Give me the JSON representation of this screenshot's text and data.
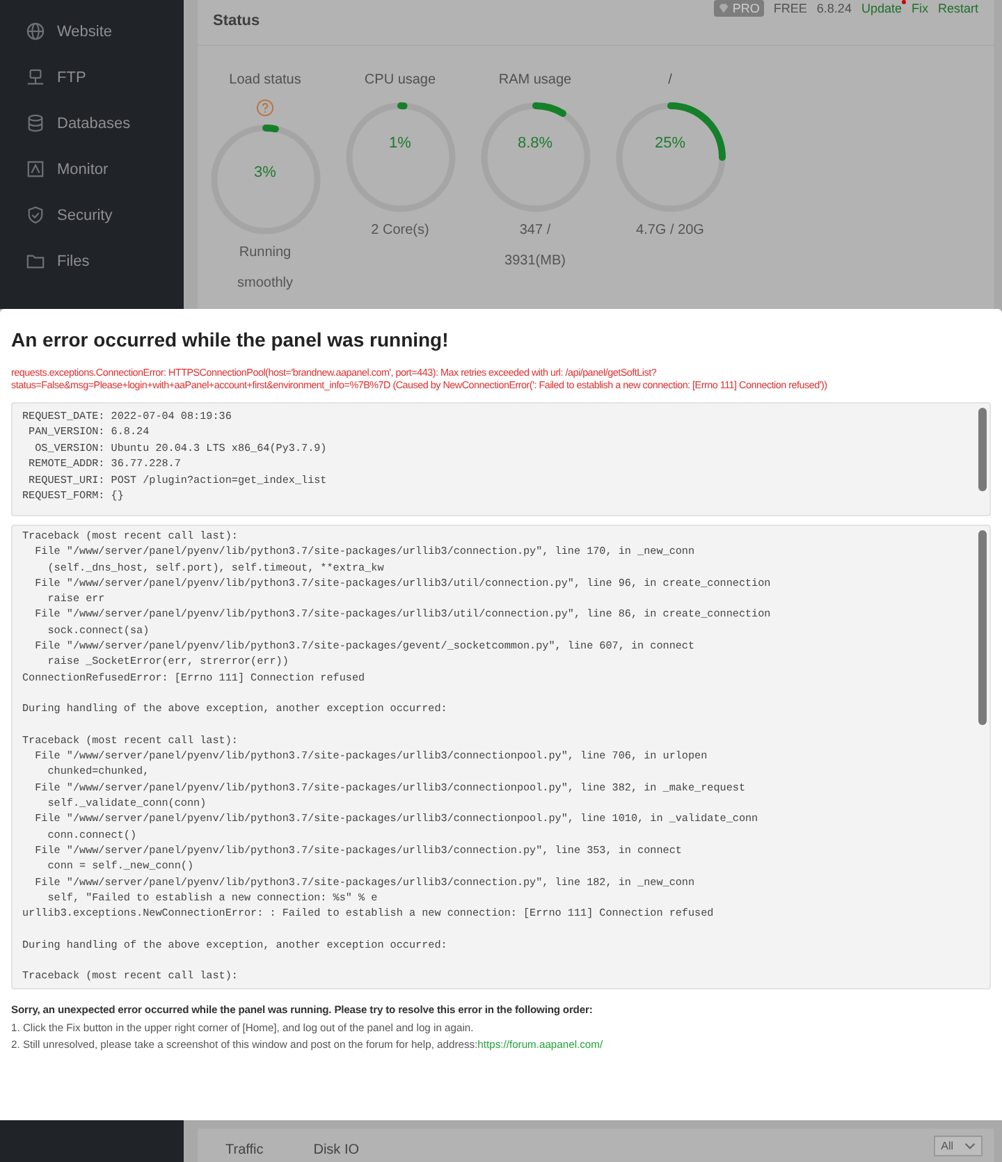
{
  "sidebar": {
    "items": [
      {
        "label": "Website"
      },
      {
        "label": "FTP"
      },
      {
        "label": "Databases"
      },
      {
        "label": "Monitor"
      },
      {
        "label": "Security"
      },
      {
        "label": "Files"
      }
    ]
  },
  "header": {
    "title": "Status",
    "badge": "PRO",
    "edition": "FREE",
    "version": "6.8.24",
    "links": [
      {
        "label": "Update",
        "notice": true
      },
      {
        "label": "Fix",
        "notice": false
      },
      {
        "label": "Restart",
        "notice": false
      }
    ]
  },
  "gauges": [
    {
      "label": "Load status",
      "help": true,
      "level": 0.03,
      "value": "3%",
      "caption": [
        "Running",
        "smoothly"
      ]
    },
    {
      "label": "CPU usage",
      "help": false,
      "level": 0.01,
      "value": "1%",
      "caption": [
        "2 Core(s)"
      ]
    },
    {
      "label": "RAM usage",
      "help": false,
      "level": 0.088,
      "value": "8.8%",
      "caption": [
        "347 /",
        "3931(MB)"
      ]
    },
    {
      "label": "/",
      "help": false,
      "level": 0.25,
      "value": "25%",
      "caption": [
        "4.7G / 20G"
      ]
    }
  ],
  "modal": {
    "title": "An error occurred while the panel was running!",
    "error": "requests.exceptions.ConnectionError: HTTPSConnectionPool(host='brandnew.aapanel.com', port=443): Max retries exceeded with url: /api/panel/getSoftList?status=False&msg=Please+login+with+aaPanel+account+first&environment_info=%7B%7D (Caused by NewConnectionError(': Failed to establish a new connection: [Errno 111] Connection refused'))",
    "request_info": [
      "REQUEST_DATE: 2022-07-04 08:19:36",
      " PAN_VERSION: 6.8.24",
      "  OS_VERSION: Ubuntu 20.04.3 LTS x86_64(Py3.7.9)",
      " REMOTE_ADDR: 36.77.228.7",
      " REQUEST_URI: POST /plugin?action=get_index_list",
      "REQUEST_FORM: {}"
    ],
    "traceback": [
      [
        "Traceback (most recent call last):",
        "  File \"/www/server/panel/pyenv/lib/python3.7/site-packages/urllib3/connection.py\", line 170, in _new_conn",
        "    (self._dns_host, self.port), self.timeout, **extra_kw",
        "  File \"/www/server/panel/pyenv/lib/python3.7/site-packages/urllib3/util/connection.py\", line 96, in create_connection",
        "    raise err",
        "  File \"/www/server/panel/pyenv/lib/python3.7/site-packages/urllib3/util/connection.py\", line 86, in create_connection",
        "    sock.connect(sa)",
        "  File \"/www/server/panel/pyenv/lib/python3.7/site-packages/gevent/_socketcommon.py\", line 607, in connect",
        "    raise _SocketError(err, strerror(err))",
        "ConnectionRefusedError: [Errno 111] Connection refused"
      ],
      [
        "During handling of the above exception, another exception occurred:"
      ],
      [
        "Traceback (most recent call last):",
        "  File \"/www/server/panel/pyenv/lib/python3.7/site-packages/urllib3/connectionpool.py\", line 706, in urlopen",
        "    chunked=chunked,",
        "  File \"/www/server/panel/pyenv/lib/python3.7/site-packages/urllib3/connectionpool.py\", line 382, in _make_request",
        "    self._validate_conn(conn)",
        "  File \"/www/server/panel/pyenv/lib/python3.7/site-packages/urllib3/connectionpool.py\", line 1010, in _validate_conn",
        "    conn.connect()",
        "  File \"/www/server/panel/pyenv/lib/python3.7/site-packages/urllib3/connection.py\", line 353, in connect",
        "    conn = self._new_conn()",
        "  File \"/www/server/panel/pyenv/lib/python3.7/site-packages/urllib3/connection.py\", line 182, in _new_conn",
        "    self, \"Failed to establish a new connection: %s\" % e",
        "urllib3.exceptions.NewConnectionError: : Failed to establish a new connection: [Errno 111] Connection refused"
      ],
      [
        "During handling of the above exception, another exception occurred:"
      ],
      [
        "Traceback (most recent call last):"
      ]
    ],
    "help_heading": "Sorry, an unexpected error occurred while the panel was running. Please try to resolve this error in the following order:",
    "steps": [
      {
        "text": "1. Click the Fix button in the upper right corner of [Home], and log out of the panel and log in again."
      },
      {
        "text": "2. Still unresolved, please take a screenshot of this window and post on the forum for help, address:",
        "link": "https://forum.aapanel.com/"
      }
    ]
  },
  "bottom": {
    "tabs": [
      "Traffic",
      "Disk IO"
    ],
    "select": "All"
  }
}
